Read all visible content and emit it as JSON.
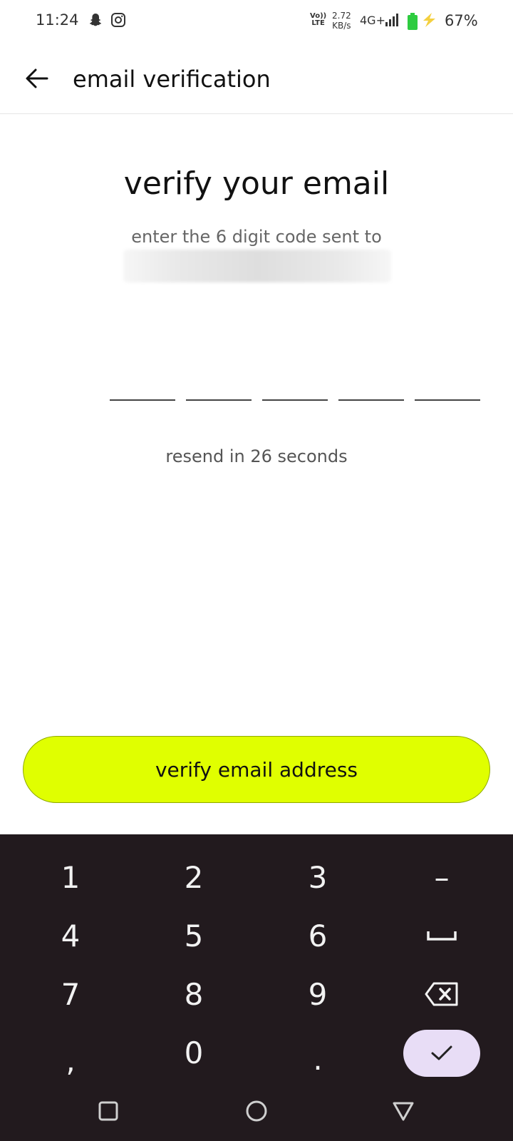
{
  "status_bar": {
    "time": "11:24",
    "volte_line1": "Vo))",
    "volte_line2": "LTE",
    "speed_value": "2.72",
    "speed_unit": "KB/s",
    "network": "4G+",
    "battery_percent": "67%",
    "icons": [
      "snapchat-icon",
      "instagram-icon",
      "signal-icon",
      "battery-icon",
      "charging-icon"
    ]
  },
  "header": {
    "title": "email verification",
    "back_icon": "arrow-left-icon"
  },
  "main": {
    "title": "verify your email",
    "subtitle": "enter the 6 digit code sent to",
    "code_slots": [
      "",
      "",
      "",
      "",
      ""
    ],
    "resend": "resend in 26 seconds"
  },
  "verify_button": {
    "label": "verify email address",
    "color": "#e0ff00"
  },
  "keyboard": {
    "background": "#221a1e",
    "keys": {
      "k1": "1",
      "k2": "2",
      "k3": "3",
      "dash": "–",
      "k4": "4",
      "k5": "5",
      "k6": "6",
      "k7": "7",
      "k8": "8",
      "k9": "9",
      "comma": ",",
      "k0": "0",
      "period": "."
    },
    "icons": [
      "space-icon",
      "backspace-icon",
      "check-icon"
    ]
  },
  "navigation": {
    "icons": [
      "recents-icon",
      "home-icon",
      "back-nav-icon"
    ]
  }
}
